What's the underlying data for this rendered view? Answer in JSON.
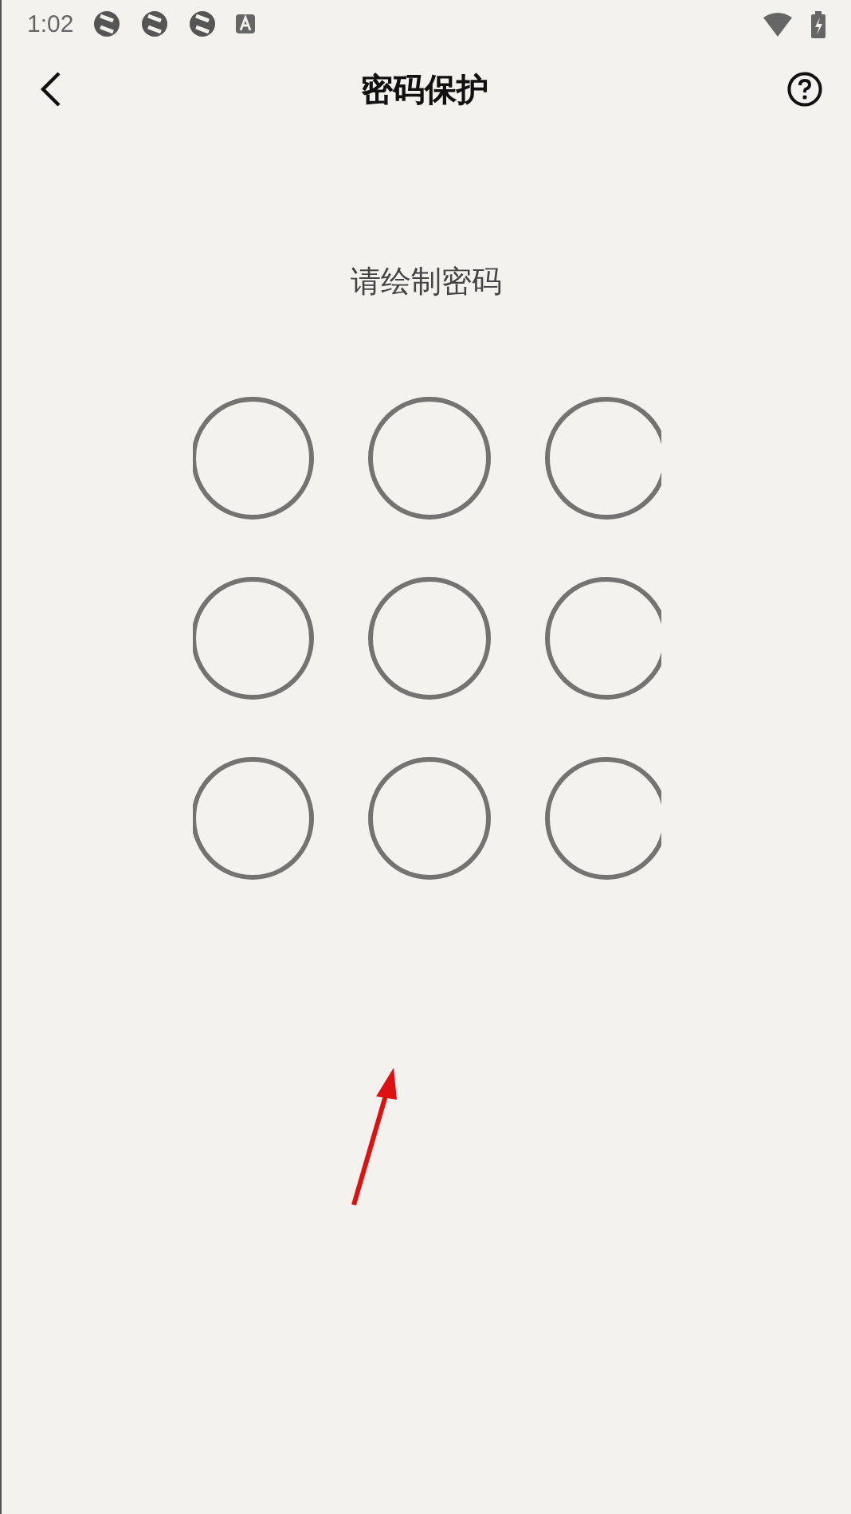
{
  "status_bar": {
    "time": "1:02"
  },
  "header": {
    "title": "密码保护"
  },
  "prompt": "请绘制密码",
  "pattern_dots": [
    {
      "selected": false
    },
    {
      "selected": false
    },
    {
      "selected": false
    },
    {
      "selected": false
    },
    {
      "selected": false
    },
    {
      "selected": false
    },
    {
      "selected": false
    },
    {
      "selected": false
    },
    {
      "selected": false
    }
  ]
}
